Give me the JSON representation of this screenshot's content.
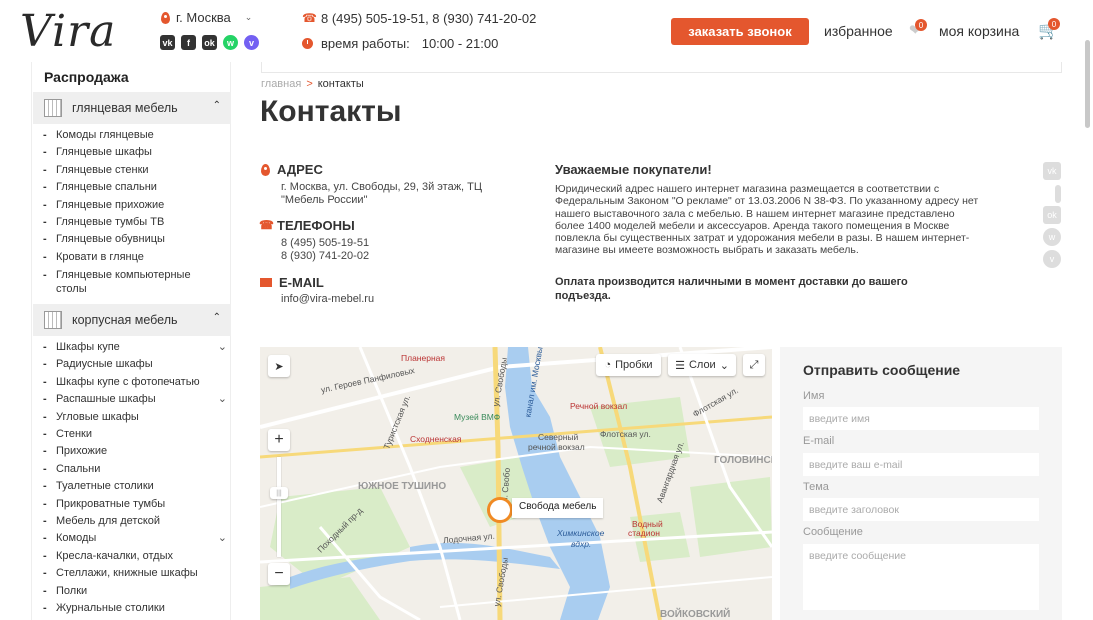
{
  "header": {
    "logo": "Vira",
    "city": "г. Москва",
    "phones": "8 (495) 505-19-51,   8 (930) 741-20-02",
    "hours_label": "время работы:",
    "hours_value": "10:00 - 21:00",
    "call_button": "заказать звонок",
    "favorites_label": "избранное",
    "favorites_count": "0",
    "cart_label": "моя корзина",
    "cart_count": "0",
    "socials": [
      "vk",
      "fb",
      "ok",
      "whatsapp",
      "viber"
    ]
  },
  "sidebar": {
    "sale": "Распродажа",
    "cat1": {
      "label": "глянцевая мебель",
      "items": [
        "Комоды глянцевые",
        "Глянцевые шкафы",
        "Глянцевые стенки",
        "Глянцевые спальни",
        "Глянцевые прихожие",
        "Глянцевые тумбы ТВ",
        "Глянцевые обувницы",
        "Кровати в глянце",
        "Глянцевые компьютерные столы"
      ]
    },
    "cat2": {
      "label": "корпусная мебель",
      "items": [
        "Шкафы купе",
        "Радиусные шкафы",
        "Шкафы купе с фотопечатью",
        "Распашные шкафы",
        "Угловые шкафы",
        "Стенки",
        "Прихожие",
        "Спальни",
        "Туалетные столики",
        "Прикроватные тумбы",
        "Мебель для детской",
        "Комоды",
        "Кресла-качалки, отдых",
        "Стеллажи, книжные шкафы",
        "Полки",
        "Журнальные столики"
      ]
    }
  },
  "breadcrumb": {
    "home": "главная",
    "sep": ">",
    "current": "контакты"
  },
  "page_title": "Контакты",
  "contacts": {
    "address_title": "АДРЕС",
    "address_line1": "г. Москва, ул. Свободы, 29, 3й этаж, ТЦ",
    "address_line2": "\"Мебель России\"",
    "phones_title": "ТЕЛЕФОНЫ",
    "phone1": "8 (495) 505-19-51",
    "phone2": "8 (930) 741-20-02",
    "email_title": "E-MAIL",
    "email": "info@vira-mebel.ru"
  },
  "notice": {
    "title": "Уважаемые покупатели!",
    "text": "Юридический адрес нашего интернет магазина размещается в соответствии с Федеральным Законом \"О рекламе\" от 13.03.2006 N 38-ФЗ. По указанному адресу нет нашего выставочного зала с мебелью. В нашем интернет магазине представлено более 1400 моделей мебели и аксессуаров. Аренда такого помещения в Москве повлекла бы существенных затрат и удорожания мебели в разы. В нашем интернет-магазине вы имеете возможность выбрать и заказать мебель.",
    "bold": "Оплата производится наличными в момент доставки до вашего подъезда."
  },
  "map": {
    "traffic": "Пробки",
    "layers": "Слои",
    "placemark": "Свобода мебель",
    "labels": {
      "planernaya": "Планерная",
      "geroev": "ул. Героев Панфиловых",
      "turist": "Туристская ул.",
      "kanal": "канал им. Москвы",
      "svobody1": "ул. Свободы",
      "rechnoy": "Речной вокзал",
      "muzey": "Музей ВМФ",
      "skhod": "Сходненская",
      "severny": "Северный",
      "severny2": "речной вокзал",
      "flotsk": "Флотская ул.",
      "flotsk2": "Флотская ул.",
      "avangard": "Авангардная ул.",
      "golovin": "ГОЛОВИНСК",
      "tushino": "ЮЖНОЕ ТУШИНО",
      "svobody2": "ул. Свобо",
      "pokhod": "Походный пр-д",
      "podoch": "Лодочная ул.",
      "khimki": "Химкинское",
      "khimki2": "вдхр.",
      "vodny": "Водный",
      "vodny2": "стадион",
      "svobody3": "ул. Свободы",
      "voik": "ВОЙКОВСКИЙ"
    }
  },
  "form": {
    "title": "Отправить сообщение",
    "name_label": "Имя",
    "name_placeholder": "введите имя",
    "email_label": "E-mail",
    "email_placeholder": "введите ваш e-mail",
    "subject_label": "Тема",
    "subject_placeholder": "введите заголовок",
    "message_label": "Сообщение",
    "message_placeholder": "введите сообщение"
  },
  "colors": {
    "accent": "#e4572e",
    "placemark": "#f08a24"
  }
}
